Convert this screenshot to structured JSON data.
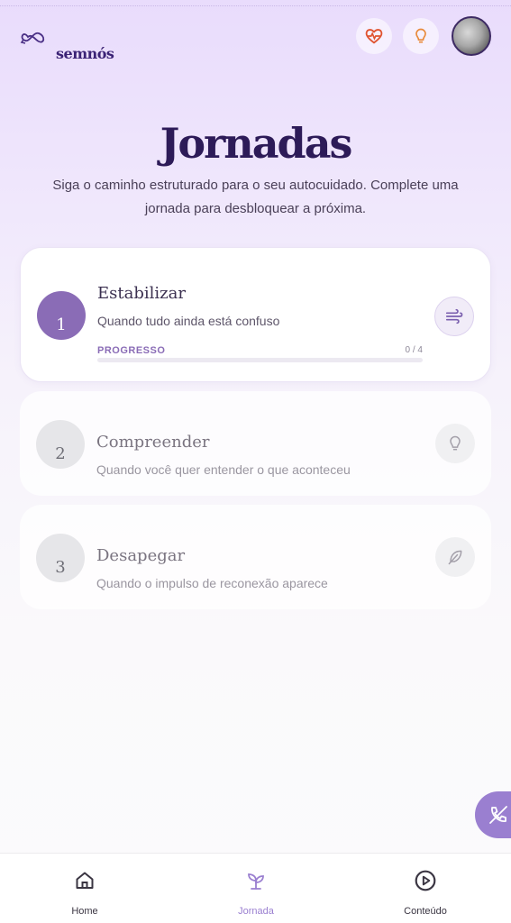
{
  "app": {
    "brand": "semnós"
  },
  "header": {
    "health_icon": "heart-pulse-icon",
    "tips_icon": "lightbulb-icon"
  },
  "page": {
    "title": "Jornadas",
    "subtitle": "Siga o caminho estruturado para o seu autocuidado. Complete uma jornada para desbloquear a próxima."
  },
  "journeys": [
    {
      "number": "1",
      "title": "Estabilizar",
      "description": "Quando tudo ainda está confuso",
      "icon": "wind-icon",
      "active": true,
      "progress_label": "PROGRESSO",
      "progress_text": "0 / 4",
      "progress_fraction": 0
    },
    {
      "number": "2",
      "title": "Compreender",
      "description": "Quando você quer entender o que aconteceu",
      "icon": "lightbulb-icon",
      "active": false
    },
    {
      "number": "3",
      "title": "Desapegar",
      "description": "Quando o impulso de reconexão aparece",
      "icon": "feather-icon",
      "active": false
    }
  ],
  "bottom_nav": [
    {
      "label": "Home",
      "icon": "home-icon"
    },
    {
      "label": "Jornada",
      "icon": "sprout-icon",
      "active": true
    },
    {
      "label": "Conteúdo",
      "icon": "play-circle-icon"
    }
  ],
  "colors": {
    "accent": "#8a6cb6",
    "title": "#2d1b58",
    "health": "#e0532f",
    "tips": "#e88a3a"
  }
}
